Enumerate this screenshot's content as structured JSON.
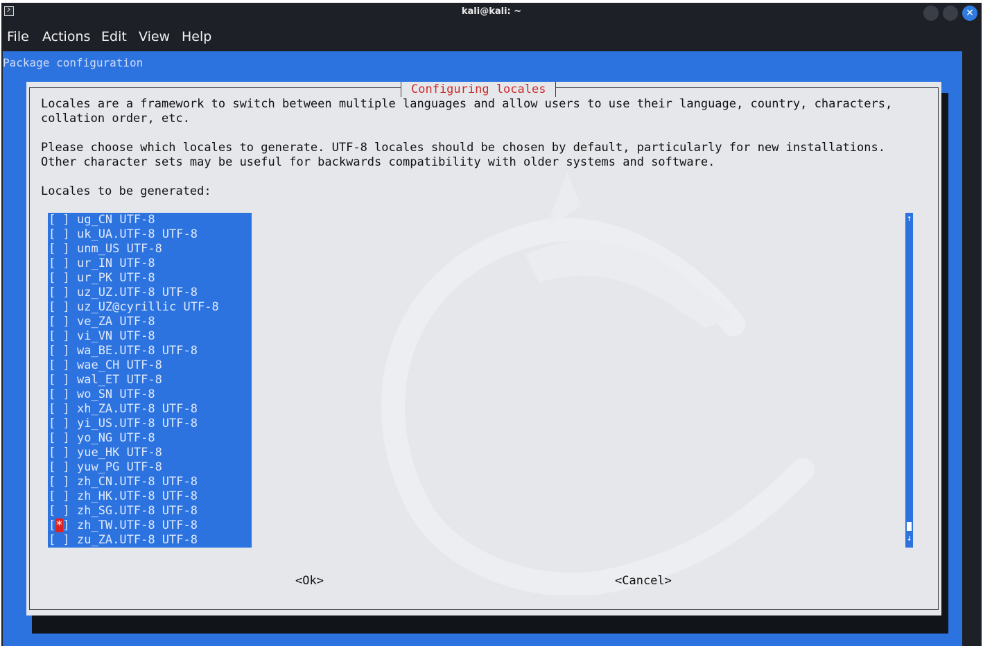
{
  "window": {
    "title": "kali@kali: ~",
    "close_glyph": "✕"
  },
  "menu": {
    "items": [
      "File",
      "Actions",
      "Edit",
      "View",
      "Help"
    ]
  },
  "terminal": {
    "backtitle": "Package configuration"
  },
  "dialog": {
    "title": "Configuring locales",
    "desc_line1": "Locales are a framework to switch between multiple languages and allow users to use their language, country, characters,",
    "desc_line2": "collation order, etc.",
    "desc_line3": "Please choose which locales to generate. UTF-8 locales should be chosen by default, particularly for new installations.",
    "desc_line4": "Other character sets may be useful for backwards compatibility with older systems and software.",
    "list_label": "Locales to be generated:",
    "locales": [
      {
        "name": "ug_CN UTF-8",
        "checked": false
      },
      {
        "name": "uk_UA.UTF-8 UTF-8",
        "checked": false
      },
      {
        "name": "unm_US UTF-8",
        "checked": false
      },
      {
        "name": "ur_IN UTF-8",
        "checked": false
      },
      {
        "name": "ur_PK UTF-8",
        "checked": false
      },
      {
        "name": "uz_UZ.UTF-8 UTF-8",
        "checked": false
      },
      {
        "name": "uz_UZ@cyrillic UTF-8",
        "checked": false
      },
      {
        "name": "ve_ZA UTF-8",
        "checked": false
      },
      {
        "name": "vi_VN UTF-8",
        "checked": false
      },
      {
        "name": "wa_BE.UTF-8 UTF-8",
        "checked": false
      },
      {
        "name": "wae_CH UTF-8",
        "checked": false
      },
      {
        "name": "wal_ET UTF-8",
        "checked": false
      },
      {
        "name": "wo_SN UTF-8",
        "checked": false
      },
      {
        "name": "xh_ZA.UTF-8 UTF-8",
        "checked": false
      },
      {
        "name": "yi_US.UTF-8 UTF-8",
        "checked": false
      },
      {
        "name": "yo_NG UTF-8",
        "checked": false
      },
      {
        "name": "yue_HK UTF-8",
        "checked": false
      },
      {
        "name": "yuw_PG UTF-8",
        "checked": false
      },
      {
        "name": "zh_CN.UTF-8 UTF-8",
        "checked": false
      },
      {
        "name": "zh_HK.UTF-8 UTF-8",
        "checked": false
      },
      {
        "name": "zh_SG.UTF-8 UTF-8",
        "checked": false
      },
      {
        "name": "zh_TW.UTF-8 UTF-8",
        "checked": true
      },
      {
        "name": "zu_ZA.UTF-8 UTF-8",
        "checked": false
      }
    ],
    "scroll_up_glyph": "↑",
    "scroll_down_glyph": "↓",
    "ok_label": "<Ok>",
    "cancel_label": "<Cancel>"
  },
  "colors": {
    "terminal_bg": "#2c73e0",
    "dialog_bg": "#e5e7eb",
    "title_red": "#cc2a2a",
    "checked_red": "#e02222",
    "window_dark": "#1d2127"
  }
}
